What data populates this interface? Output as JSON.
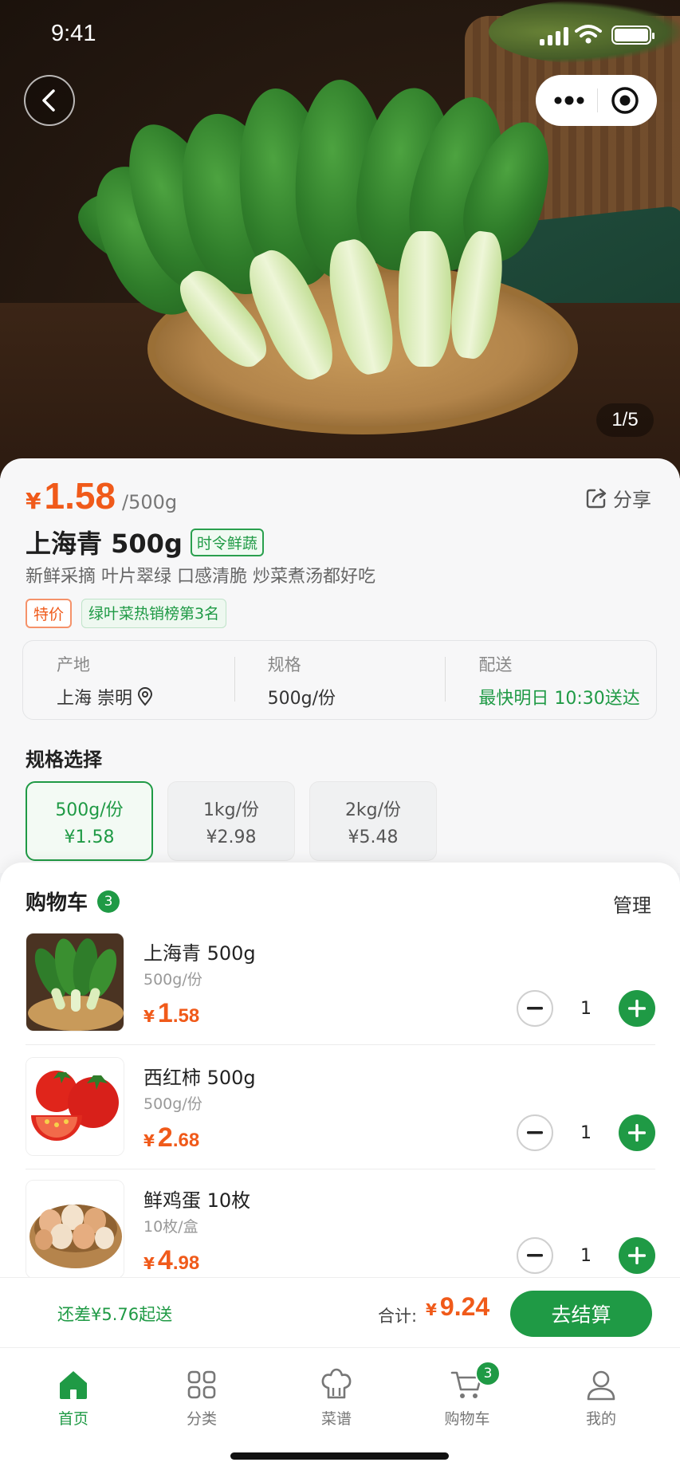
{
  "status_bar": {
    "time": "9:41"
  },
  "hero": {
    "pager": "1/5"
  },
  "product": {
    "currency": "¥",
    "price": "1.58",
    "unit": "/500g",
    "share_label": "分享",
    "title": "上海青 500g",
    "fresh_tag": "时令鲜蔬",
    "subtitle": "新鲜采摘 叶片翠绿 口感清脆 炒菜煮汤都好吃",
    "badge_special": "特价",
    "badge_rank": "绿叶菜热销榜第3名",
    "info": [
      {
        "label": "产地",
        "value": "上海 崇明"
      },
      {
        "label": "规格",
        "value": "500g/份"
      },
      {
        "label": "配送",
        "value": "最快明日 10:30送达"
      }
    ],
    "spec_title": "规格选择",
    "specs": [
      {
        "size": "500g/份",
        "price": "¥1.58",
        "selected": true
      },
      {
        "size": "1kg/份",
        "price": "¥2.98",
        "selected": false
      },
      {
        "size": "2kg/份",
        "price": "¥5.48",
        "selected": false
      }
    ]
  },
  "cart": {
    "title": "购物车",
    "count": "3",
    "manage_label": "管理",
    "items": [
      {
        "name": "上海青 500g",
        "spec": "500g/份",
        "currency": "¥",
        "price_int": "1",
        "price_dec": ".58",
        "qty": "1"
      },
      {
        "name": "西红柿 500g",
        "spec": "500g/份",
        "currency": "¥",
        "price_int": "2",
        "price_dec": ".68",
        "qty": "1"
      },
      {
        "name": "鲜鸡蛋 10枚",
        "spec": "10枚/盒",
        "currency": "¥",
        "price_int": "4",
        "price_dec": ".98",
        "qty": "1"
      }
    ]
  },
  "checkout": {
    "min_hint": "还差¥5.76起送",
    "total_label": "合计:",
    "currency": "¥",
    "total": "9.24",
    "button": "去结算"
  },
  "tabbar": {
    "items": [
      {
        "label": "首页",
        "icon": "home-icon",
        "active": true
      },
      {
        "label": "分类",
        "icon": "category-icon",
        "active": false
      },
      {
        "label": "菜谱",
        "icon": "chef-hat-icon",
        "active": false
      },
      {
        "label": "购物车",
        "icon": "cart-icon",
        "active": false,
        "badge": "3"
      },
      {
        "label": "我的",
        "icon": "profile-icon",
        "active": false
      }
    ]
  },
  "colors": {
    "brand_green": "#1f9a45",
    "price_orange": "#f05a1a"
  }
}
